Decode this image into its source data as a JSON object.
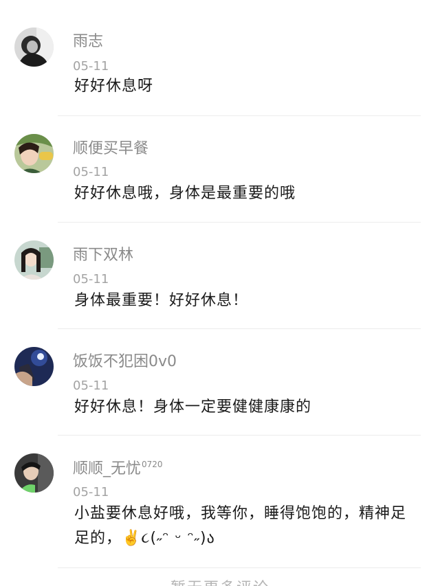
{
  "comments": [
    {
      "username": "雨志",
      "date": "05-11",
      "text": "好好休息呀",
      "avatar_icon": "avatar-user-icon"
    },
    {
      "username": "顺便买早餐",
      "date": "05-11",
      "text": "好好休息哦，身体是最重要的哦",
      "avatar_icon": "avatar-user-icon"
    },
    {
      "username": "雨下双林",
      "date": "05-11",
      "text": "身体最重要！好好休息！",
      "avatar_icon": "avatar-user-icon"
    },
    {
      "username": "饭饭不犯困0v0",
      "date": "05-11",
      "text": "好好休息！身体一定要健健康康的",
      "avatar_icon": "avatar-user-icon"
    },
    {
      "username": "顺顺_无忧",
      "username_badge": "0720",
      "date": "05-11",
      "text": "小盐要休息好哦，我等你，睡得饱饱的，精神足足的，✌️૮(˶ᵔ ᵕ ᵔ˶)ა",
      "avatar_icon": "avatar-user-icon"
    }
  ],
  "footer": {
    "more_comments_label": "暂无更多评论"
  }
}
